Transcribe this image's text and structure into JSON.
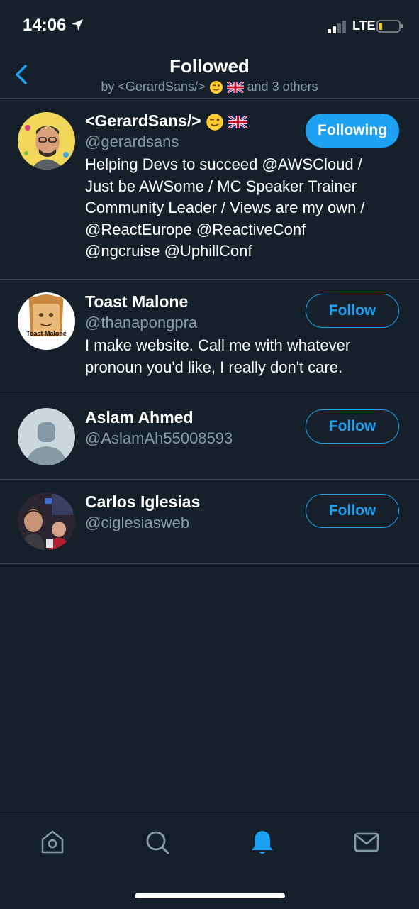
{
  "status_bar": {
    "time": "14:06",
    "network": "LTE"
  },
  "header": {
    "title": "Followed",
    "subtitle_prefix": "by <GerardSans/>",
    "subtitle_suffix": "and 3 others"
  },
  "users": [
    {
      "name": "<GerardSans/>",
      "handle": "@gerardsans",
      "button": "Following",
      "bio_lines": [
        "Helping Devs to succeed @AWSCloud /",
        "Just be AWSome / MC Speaker Trainer",
        "Community Leader / Views are my own /",
        "@ReactEurope @ReactiveConf",
        "@ngcruise @UphillConf"
      ]
    },
    {
      "name": "Toast Malone",
      "handle": "@thanapongpra",
      "button": "Follow",
      "avatar_text": "Toast Malone",
      "bio_lines": [
        "I make website. Call me with whatever",
        "pronoun you'd like, I really don't care."
      ]
    },
    {
      "name": "Aslam Ahmed",
      "handle": "@AslamAh55008593",
      "button": "Follow"
    },
    {
      "name": "Carlos Iglesias",
      "handle": "@ciglesiasweb",
      "button": "Follow"
    }
  ],
  "tabs": [
    "home-icon",
    "search-icon",
    "notifications-icon",
    "messages-icon"
  ],
  "colors": {
    "background": "#15202b",
    "accent": "#1da1f2",
    "secondary_text": "#8899a6",
    "divider": "#38444d"
  }
}
